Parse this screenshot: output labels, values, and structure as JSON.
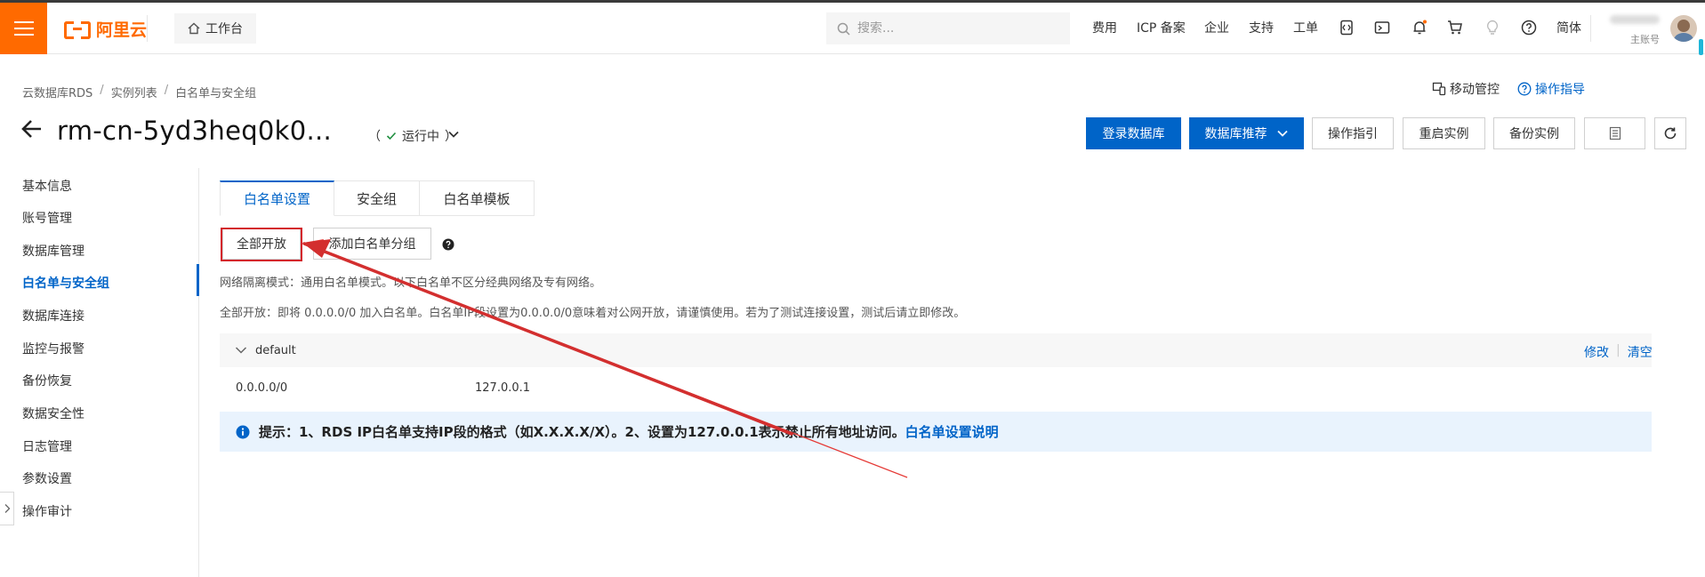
{
  "header": {
    "logo_text": "阿里云",
    "workbench_label": "工作台",
    "search_placeholder": "搜索...",
    "nav_links": [
      "费用",
      "ICP 备案",
      "企业",
      "支持",
      "工单"
    ],
    "lang_label": "简体",
    "account_sub": "主账号"
  },
  "breadcrumb": [
    "云数据库RDS",
    "实例列表",
    "白名单与安全组"
  ],
  "breadcrumb_sep": "/",
  "top_right": {
    "mobile_label": "移动管控",
    "guide_label": "操作指导"
  },
  "instance": {
    "title": "rm-cn-5yd3heq0k0...",
    "status": "运行中",
    "status_paren_open": "（",
    "status_paren_close": "）"
  },
  "actions": {
    "login_db": "登录数据库",
    "db_recommend": "数据库推荐",
    "op_guide": "操作指引",
    "restart": "重启实例",
    "backup": "备份实例"
  },
  "sidebar": {
    "items": [
      "基本信息",
      "账号管理",
      "数据库管理",
      "白名单与安全组",
      "数据库连接",
      "监控与报警",
      "备份恢复",
      "数据安全性",
      "日志管理",
      "参数设置",
      "操作审计"
    ],
    "active_index": 3
  },
  "tabs": [
    "白名单设置",
    "安全组",
    "白名单模板"
  ],
  "toolbar": {
    "open_all": "全部开放",
    "add_group": "添加白名单分组"
  },
  "notes": {
    "isolation": "网络隔离模式：通用白名单模式。以下白名单不区分经典网络及专有网络。",
    "open_all_desc": "全部开放：即将 0.0.0.0/0 加入白名单。白名单IP段设置为0.0.0.0/0意味着对公网开放，请谨慎使用。若为了测试连接设置，测试后请立即修改。"
  },
  "group": {
    "name": "default",
    "edit": "修改",
    "clear": "清空",
    "ips": [
      "0.0.0.0/0",
      "127.0.0.1"
    ]
  },
  "tip": {
    "text": "提示：1、RDS IP白名单支持IP段的格式（如X.X.X.X/X）。2、设置为127.0.0.1表示禁止所有地址访问。",
    "link": "白名单设置说明"
  },
  "colors": {
    "brand_orange": "#ff6a00",
    "primary_blue": "#0064c8",
    "annotation_red": "#d3232b"
  }
}
